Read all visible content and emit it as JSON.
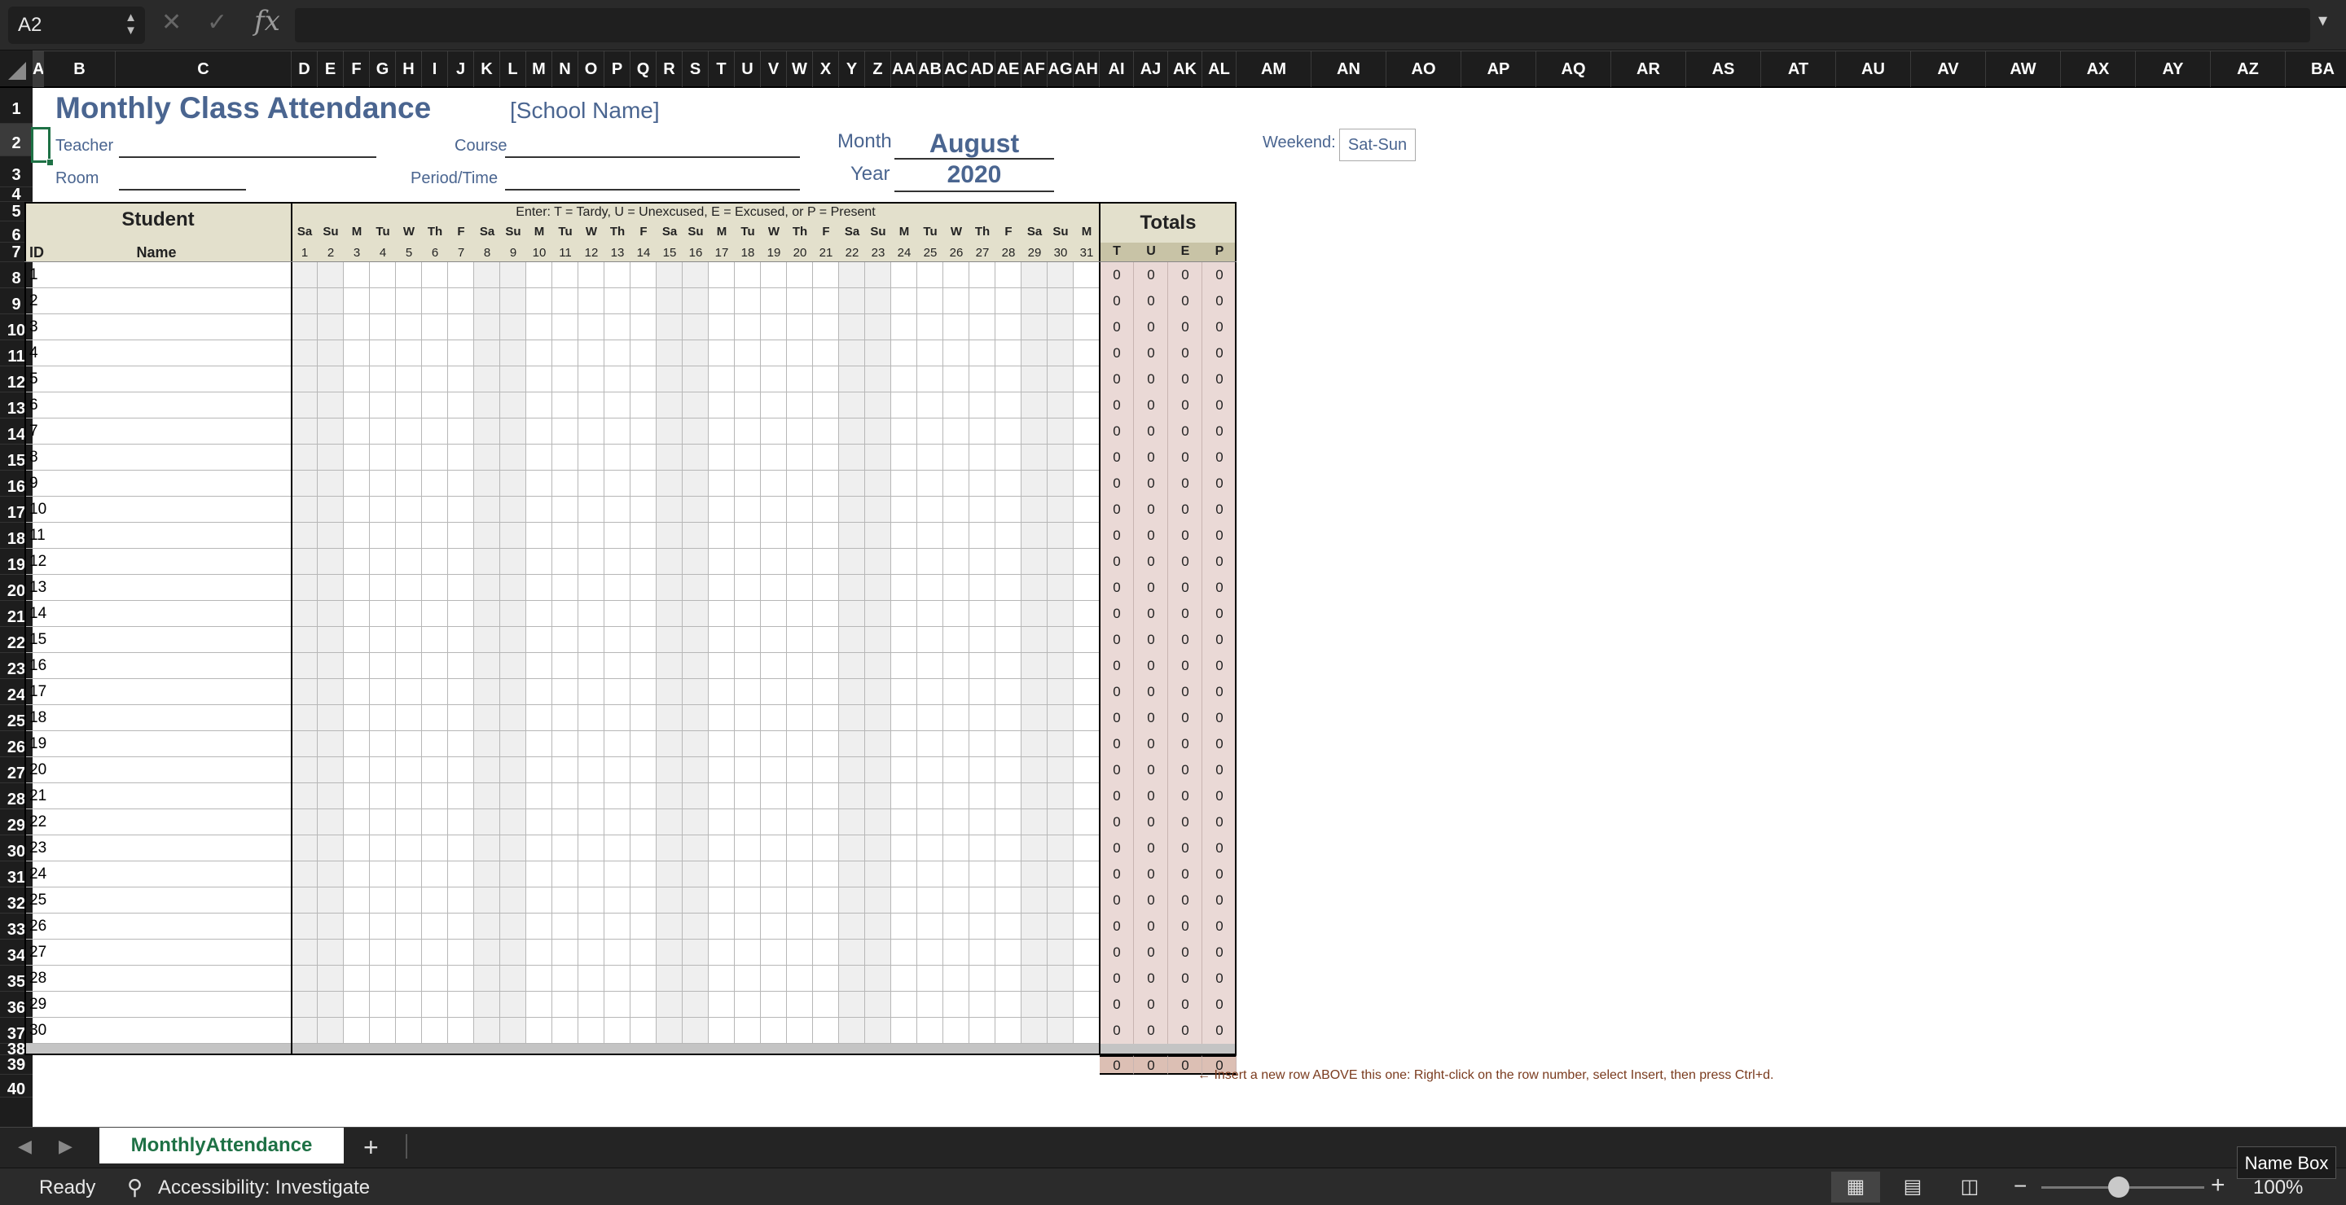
{
  "formula_bar": {
    "name_box": "A2",
    "fx": "fx",
    "formula": ""
  },
  "columns": [
    "A",
    "B",
    "C",
    "D",
    "E",
    "F",
    "G",
    "H",
    "I",
    "J",
    "K",
    "L",
    "M",
    "N",
    "O",
    "P",
    "Q",
    "R",
    "S",
    "T",
    "U",
    "V",
    "W",
    "X",
    "Y",
    "Z",
    "AA",
    "AB",
    "AC",
    "AD",
    "AE",
    "AF",
    "AG",
    "AH",
    "AI",
    "AJ",
    "AK",
    "AL",
    "AM",
    "AN",
    "AO",
    "AP",
    "AQ",
    "AR",
    "AS",
    "AT",
    "AU",
    "AV",
    "AW",
    "AX",
    "AY",
    "AZ",
    "BA"
  ],
  "rows": [
    "1",
    "2",
    "3",
    "4",
    "5",
    "6",
    "7",
    "8",
    "9",
    "10",
    "11",
    "12",
    "13",
    "14",
    "15",
    "16",
    "17",
    "18",
    "19",
    "20",
    "21",
    "22",
    "23",
    "24",
    "25",
    "26",
    "27",
    "28",
    "29",
    "30",
    "31",
    "32",
    "33",
    "34",
    "35",
    "36",
    "37",
    "38",
    "39",
    "40"
  ],
  "sheet": {
    "title": "Monthly Class Attendance",
    "school": "[School Name]",
    "teacher_label": "Teacher",
    "room_label": "Room",
    "course_label": "Course",
    "period_label": "Period/Time",
    "month_label": "Month",
    "month_value": "August",
    "year_label": "Year",
    "year_value": "2020",
    "weekend_label": "Weekend:",
    "weekend_value": "Sat-Sun",
    "student_header": "Student",
    "id_header": "ID",
    "name_header": "Name",
    "instructions": "Enter: T = Tardy,  U = Unexcused,  E = Excused,  or P = Present",
    "totals_header": "Totals",
    "total_cols": [
      "T",
      "U",
      "E",
      "P"
    ],
    "day_names": [
      "Sa",
      "Su",
      "M",
      "Tu",
      "W",
      "Th",
      "F",
      "Sa",
      "Su",
      "M",
      "Tu",
      "W",
      "Th",
      "F",
      "Sa",
      "Su",
      "M",
      "Tu",
      "W",
      "Th",
      "F",
      "Sa",
      "Su",
      "M",
      "Tu",
      "W",
      "Th",
      "F",
      "Sa",
      "Su",
      "M"
    ],
    "day_nums": [
      "1",
      "2",
      "3",
      "4",
      "5",
      "6",
      "7",
      "8",
      "9",
      "10",
      "11",
      "12",
      "13",
      "14",
      "15",
      "16",
      "17",
      "18",
      "19",
      "20",
      "21",
      "22",
      "23",
      "24",
      "25",
      "26",
      "27",
      "28",
      "29",
      "30",
      "31"
    ],
    "student_ids": [
      "1",
      "2",
      "3",
      "4",
      "5",
      "6",
      "7",
      "8",
      "9",
      "10",
      "11",
      "12",
      "13",
      "14",
      "15",
      "16",
      "17",
      "18",
      "19",
      "20",
      "21",
      "22",
      "23",
      "24",
      "25",
      "26",
      "27",
      "28",
      "29",
      "30"
    ],
    "totals_value": "0",
    "grand_totals": [
      "0",
      "0",
      "0",
      "0"
    ],
    "insert_note": "← Insert a new row ABOVE this one: Right-click on the row number, select Insert, then press Ctrl+d."
  },
  "tabs": {
    "active": "MonthlyAttendance",
    "add": "+"
  },
  "status": {
    "ready": "Ready",
    "accessibility": "Accessibility: Investigate",
    "zoom": "100%",
    "tooltip": "Name Box"
  },
  "colors": {
    "accent": "#1e7145",
    "title": "#4a6590",
    "header_bg": "#e3e0cc",
    "totals_bg": "#ead9d6"
  }
}
